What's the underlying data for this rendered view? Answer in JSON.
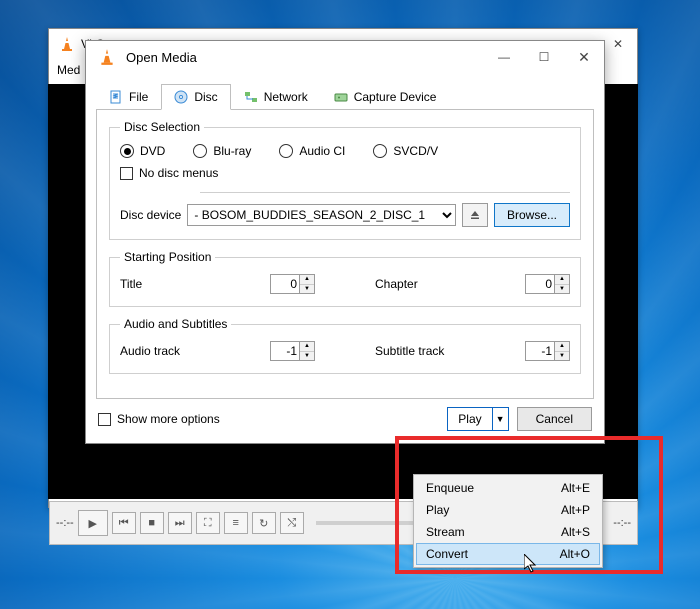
{
  "back_window": {
    "title": "VLC",
    "menu_first": "Med",
    "minimize": "—",
    "maximize": "▢",
    "close": "✕"
  },
  "playback": {
    "time_left": "--:--",
    "time_right": "--:--"
  },
  "dialog": {
    "title": "Open Media",
    "controls": {
      "min": "—",
      "max": "☐",
      "close": "✕"
    },
    "tabs": {
      "file": "File",
      "disc": "Disc",
      "network": "Network",
      "capture": "Capture Device"
    },
    "disc_selection": {
      "legend": "Disc Selection",
      "dvd": "DVD",
      "bluray": "Blu-ray",
      "audiocd": "Audio CI",
      "svcd": "SVCD/V",
      "no_menus": "No disc menus",
      "device_label": "Disc device",
      "device_value": "- BOSOM_BUDDIES_SEASON_2_DISC_1",
      "browse": "Browse..."
    },
    "starting": {
      "legend": "Starting Position",
      "title": "Title",
      "title_val": "0",
      "chapter": "Chapter",
      "chapter_val": "0"
    },
    "audio_sub": {
      "legend": "Audio and Subtitles",
      "audio": "Audio track",
      "audio_val": "-1",
      "subtitle": "Subtitle track",
      "subtitle_val": "-1"
    },
    "show_more": "Show more options",
    "play": "Play",
    "cancel": "Cancel"
  },
  "menu": {
    "items": [
      {
        "label": "Enqueue",
        "shortcut": "Alt+E"
      },
      {
        "label": "Play",
        "shortcut": "Alt+P"
      },
      {
        "label": "Stream",
        "shortcut": "Alt+S"
      },
      {
        "label": "Convert",
        "shortcut": "Alt+O"
      }
    ],
    "hover_index": 3
  }
}
